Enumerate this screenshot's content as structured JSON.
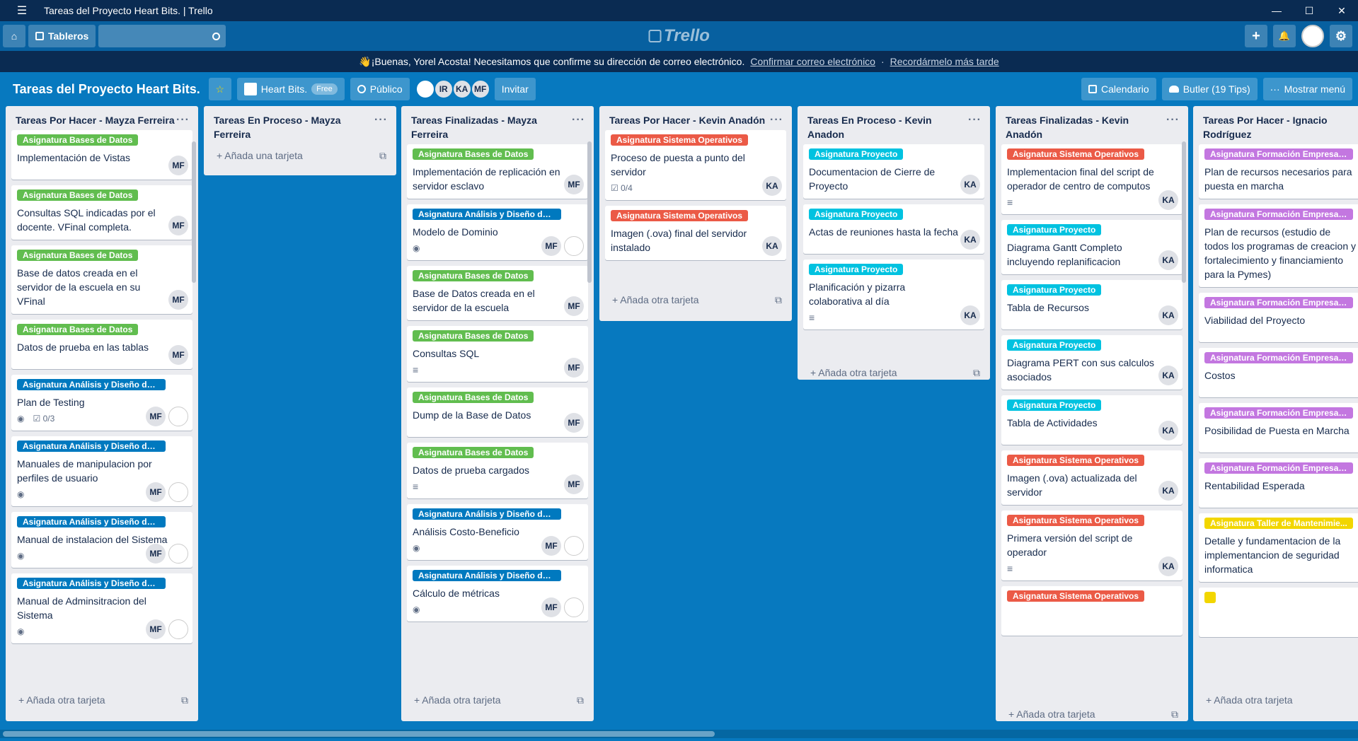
{
  "window": {
    "title": "Tareas del Proyecto Heart Bits. | Trello",
    "menu_icon": "☰",
    "min": "—",
    "max": "☐",
    "close": "✕"
  },
  "header": {
    "home_icon": "⌂",
    "boards_label": "Tableros",
    "search_placeholder": "",
    "logo": "Trello",
    "add_icon": "+",
    "bell_icon": "🔔",
    "gear_icon": "⚙"
  },
  "banner": {
    "text": "👋¡Buenas, Yorel Acosta! Necesitamos que confirme su dirección de correo electrónico.",
    "confirm": "Confirmar correo electrónico",
    "sep": "·",
    "later": "Recordármelo más tarde"
  },
  "board": {
    "title": "Tareas del Proyecto Heart Bits.",
    "star": "☆",
    "team": "Heart Bits.",
    "free": "Free",
    "visibility": "Público",
    "members": [
      "IR",
      "KA",
      "MF"
    ],
    "invite": "Invitar",
    "calendar": "Calendario",
    "butler": "Butler (19 Tips)",
    "menu": "Mostrar menú"
  },
  "colors": {
    "green": "#61bd4f",
    "blue": "#0079bf",
    "red": "#eb5a46",
    "cyan": "#00c2e0",
    "purple": "#c377e0",
    "yellow": "#f2d600"
  },
  "lists": [
    {
      "title": "Tareas Por Hacer - Mayza Ferreira",
      "add": "Añada otra tarjeta",
      "cards": [
        {
          "label": "Asignatura Bases de Datos",
          "color": "lg",
          "title": "Implementación de Vistas",
          "member": "MF"
        },
        {
          "label": "Asignatura Bases de Datos",
          "color": "lg",
          "title": "Consultas SQL indicadas por el docente. VFinal completa.",
          "member": "MF"
        },
        {
          "label": "Asignatura Bases de Datos",
          "color": "lg",
          "title": "Base de datos creada en el servidor de la escuela en su VFinal",
          "member": "MF"
        },
        {
          "label": "Asignatura Bases de Datos",
          "color": "lg",
          "title": "Datos de prueba en las tablas",
          "member": "MF"
        },
        {
          "label": "Asignatura Análisis y Diseño de ...",
          "color": "lb",
          "title": "Plan de Testing",
          "member": "MF",
          "eye": true,
          "check": "0/3",
          "img": true
        },
        {
          "label": "Asignatura Análisis y Diseño de ...",
          "color": "lb",
          "title": "Manuales de manipulacion por perfiles de usuario",
          "member": "MF",
          "eye": true,
          "img": true
        },
        {
          "label": "Asignatura Análisis y Diseño de ...",
          "color": "lb",
          "title": "Manual de instalacion del Sistema",
          "member": "MF",
          "eye": true,
          "img": true
        },
        {
          "label": "Asignatura Análisis y Diseño de ...",
          "color": "lb",
          "title": "Manual de Adminsitracion del Sistema",
          "member": "MF",
          "eye": true,
          "img": true
        }
      ]
    },
    {
      "title": "Tareas En Proceso - Mayza Ferreira",
      "add": "Añada una tarjeta",
      "cards": []
    },
    {
      "title": "Tareas Finalizadas - Mayza Ferreira",
      "add": "Añada otra tarjeta",
      "cards": [
        {
          "label": "Asignatura Bases de Datos",
          "color": "lg",
          "title": "Implementación de replicación en servidor esclavo",
          "member": "MF"
        },
        {
          "label": "Asignatura Análisis y Diseño de ...",
          "color": "lb",
          "title": "Modelo de Dominio",
          "member": "MF",
          "eye": true,
          "img": true
        },
        {
          "label": "Asignatura Bases de Datos",
          "color": "lg",
          "title": "Base de Datos creada en el servidor de la escuela",
          "member": "MF"
        },
        {
          "label": "Asignatura Bases de Datos",
          "color": "lg",
          "title": "Consultas SQL",
          "member": "MF",
          "desc": true
        },
        {
          "label": "Asignatura Bases de Datos",
          "color": "lg",
          "title": "Dump de la Base de Datos",
          "member": "MF"
        },
        {
          "label": "Asignatura Bases de Datos",
          "color": "lg",
          "title": "Datos de prueba cargados",
          "member": "MF",
          "desc": true
        },
        {
          "label": "Asignatura Análisis y Diseño de ...",
          "color": "lb",
          "title": "Análisis Costo-Beneficio",
          "member": "MF",
          "eye": true,
          "img": true
        },
        {
          "label": "Asignatura Análisis y Diseño de ...",
          "color": "lb",
          "title": "Cálculo de métricas",
          "member": "MF",
          "eye": true,
          "img": true
        }
      ]
    },
    {
      "title": "Tareas Por Hacer - Kevin Anadón",
      "add": "Añada otra tarjeta",
      "cards": [
        {
          "label": "Asignatura Sistema Operativos",
          "color": "lr",
          "title": "Proceso de puesta a punto del servidor",
          "member": "KA",
          "check": "0/4"
        },
        {
          "label": "Asignatura Sistema Operativos",
          "color": "lr",
          "title": "Imagen (.ova) final del servidor instalado",
          "member": "KA"
        }
      ]
    },
    {
      "title": "Tareas En Proceso - Kevin Anadon",
      "add": "Añada otra tarjeta",
      "cards": [
        {
          "label": "Asignatura Proyecto",
          "color": "lc",
          "title": "Documentacion de Cierre de Proyecto",
          "member": "KA"
        },
        {
          "label": "Asignatura Proyecto",
          "color": "lc",
          "title": "Actas de reuniones hasta la fecha",
          "member": "KA"
        },
        {
          "label": "Asignatura Proyecto",
          "color": "lc",
          "title": "Planificación y pizarra colaborativa al día",
          "member": "KA",
          "desc": true
        }
      ]
    },
    {
      "title": "Tareas Finalizadas - Kevin Anadón",
      "add": "Añada otra tarjeta",
      "cards": [
        {
          "label": "Asignatura Sistema Operativos",
          "color": "lr",
          "title": "Implementacion final del script de operador de centro de computos",
          "member": "KA",
          "desc": true
        },
        {
          "label": "Asignatura Proyecto",
          "color": "lc",
          "title": "Diagrama Gantt Completo incluyendo replanificacion",
          "member": "KA"
        },
        {
          "label": "Asignatura Proyecto",
          "color": "lc",
          "title": "Tabla de Recursos",
          "member": "KA"
        },
        {
          "label": "Asignatura Proyecto",
          "color": "lc",
          "title": "Diagrama PERT con sus calculos asociados",
          "member": "KA"
        },
        {
          "label": "Asignatura Proyecto",
          "color": "lc",
          "title": "Tabla de Actividades",
          "member": "KA"
        },
        {
          "label": "Asignatura Sistema Operativos",
          "color": "lr",
          "title": "Imagen (.ova) actualizada del servidor",
          "member": "KA"
        },
        {
          "label": "Asignatura Sistema Operativos",
          "color": "lr",
          "title": "Primera versión del script de operador",
          "member": "KA",
          "desc": true
        },
        {
          "label": "Asignatura Sistema Operativos",
          "color": "lr",
          "title": "",
          "member": ""
        }
      ]
    },
    {
      "title": "Tareas Por Hacer - Ignacio Rodríguez",
      "add": "Añada otra tarjeta",
      "cards": [
        {
          "label": "Asignatura Formación Empresarial",
          "color": "lp",
          "title": "Plan de recursos necesarios para puesta en marcha",
          "member": ""
        },
        {
          "label": "Asignatura Formación Empresarial",
          "color": "lp",
          "title": "Plan de recursos (estudio de todos los programas de creacion y fortalecimiento y financiamiento para la Pymes)",
          "member": ""
        },
        {
          "label": "Asignatura Formación Empresarial",
          "color": "lp",
          "title": "Viabilidad del Proyecto",
          "member": ""
        },
        {
          "label": "Asignatura Formación Empresarial",
          "color": "lp",
          "title": "Costos",
          "member": ""
        },
        {
          "label": "Asignatura Formación Empresarial",
          "color": "lp",
          "title": "Posibilidad de Puesta en Marcha",
          "member": ""
        },
        {
          "label": "Asignatura Formación Empresarial",
          "color": "lp",
          "title": "Rentabilidad Esperada",
          "member": ""
        },
        {
          "label": "Asignatura Taller de Mantenimie...",
          "color": "ly",
          "title": "Detalle y fundamentacion de la implementancion de seguridad informatica",
          "member": ""
        },
        {
          "label": "",
          "color": "ly",
          "title": "",
          "member": ""
        }
      ]
    }
  ]
}
